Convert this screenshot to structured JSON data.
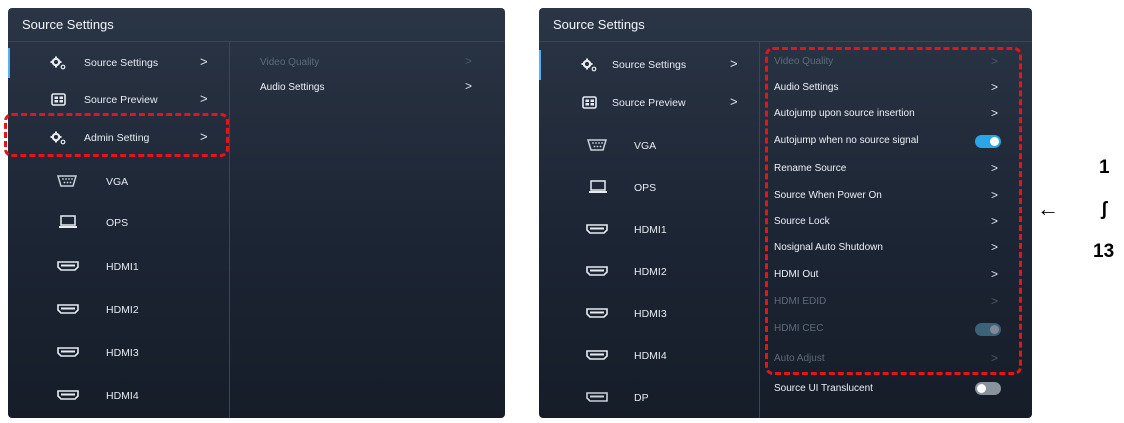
{
  "colors": {
    "panel_bg": "#1c2534",
    "accent": "#4fb4f0",
    "highlight_dash": "#e3141c",
    "toggle_on": "#2aa6e6",
    "toggle_off": "#8a929c",
    "disabled_text": "#5e6a7b"
  },
  "left_panel": {
    "title": "Source Settings",
    "nav": [
      {
        "label": "Source Settings",
        "icon": "gear-icon",
        "chevron": ">"
      },
      {
        "label": "Source Preview",
        "icon": "preview-grid-icon",
        "chevron": ">"
      },
      {
        "label": "Admin Setting",
        "icon": "gear-icon",
        "chevron": ">"
      }
    ],
    "sources": [
      {
        "label": "VGA",
        "icon": "vga-port-icon"
      },
      {
        "label": "OPS",
        "icon": "laptop-icon"
      },
      {
        "label": "HDMI1",
        "icon": "hdmi-port-icon"
      },
      {
        "label": "HDMI2",
        "icon": "hdmi-port-icon"
      },
      {
        "label": "HDMI3",
        "icon": "hdmi-port-icon"
      },
      {
        "label": "HDMI4",
        "icon": "hdmi-port-icon"
      }
    ],
    "options": [
      {
        "label": "Video Quality",
        "control": "chevron",
        "disabled": true
      },
      {
        "label": "Audio Settings",
        "control": "chevron",
        "disabled": false
      }
    ]
  },
  "right_panel": {
    "title": "Source Settings",
    "nav": [
      {
        "label": "Source Settings",
        "icon": "gear-icon",
        "chevron": ">"
      },
      {
        "label": "Source Preview",
        "icon": "preview-grid-icon",
        "chevron": ">"
      }
    ],
    "sources": [
      {
        "label": "VGA",
        "icon": "vga-port-icon"
      },
      {
        "label": "OPS",
        "icon": "laptop-icon"
      },
      {
        "label": "HDMI1",
        "icon": "hdmi-port-icon"
      },
      {
        "label": "HDMI2",
        "icon": "hdmi-port-icon"
      },
      {
        "label": "HDMI3",
        "icon": "hdmi-port-icon"
      },
      {
        "label": "HDMI4",
        "icon": "hdmi-port-icon"
      },
      {
        "label": "DP",
        "icon": "displayport-icon"
      }
    ],
    "options": [
      {
        "label": "Video Quality",
        "control": "chevron",
        "disabled": true
      },
      {
        "label": "Audio Settings",
        "control": "chevron",
        "disabled": false
      },
      {
        "label": "Autojump upon source insertion",
        "control": "chevron",
        "disabled": false
      },
      {
        "label": "Autojump when no source signal",
        "control": "toggle",
        "state": "on",
        "disabled": false
      },
      {
        "label": "Rename Source",
        "control": "chevron",
        "disabled": false
      },
      {
        "label": "Source When Power On",
        "control": "chevron",
        "disabled": false
      },
      {
        "label": "Source Lock",
        "control": "chevron",
        "disabled": false
      },
      {
        "label": "Nosignal Auto Shutdown",
        "control": "chevron",
        "disabled": false
      },
      {
        "label": "HDMI Out",
        "control": "chevron",
        "disabled": false
      },
      {
        "label": "HDMI EDID",
        "control": "chevron",
        "disabled": true
      },
      {
        "label": "HDMI CEC",
        "control": "toggle",
        "state": "on",
        "disabled": true
      },
      {
        "label": "Auto Adjust",
        "control": "chevron",
        "disabled": true
      },
      {
        "label": "Source UI Translucent",
        "control": "toggle",
        "state": "off",
        "disabled": false
      }
    ]
  },
  "annotation": {
    "top": "1",
    "mid": "ʃ",
    "bottom": "13",
    "arrow": "←"
  }
}
